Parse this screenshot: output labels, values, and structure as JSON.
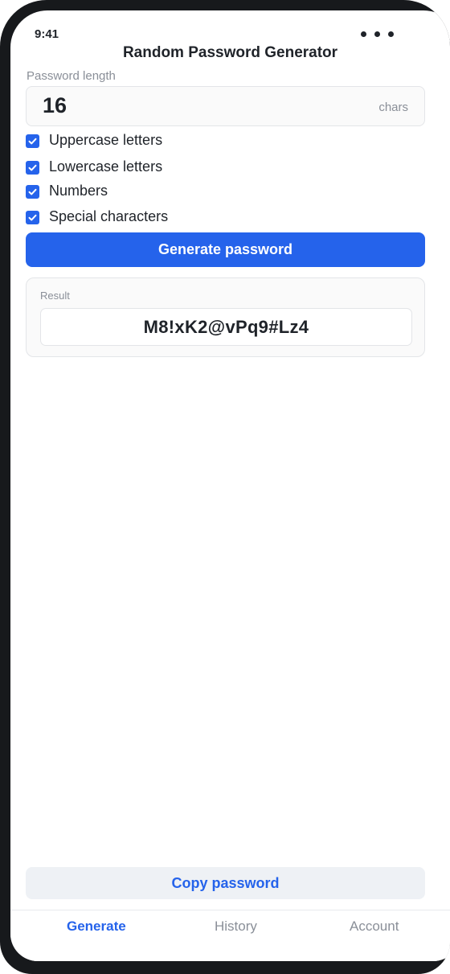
{
  "status_bar": {
    "time": "9:41"
  },
  "header": {
    "title": "Random Password Generator"
  },
  "length": {
    "label": "Password length",
    "value": "16",
    "unit": "chars"
  },
  "options": [
    {
      "label": "Uppercase letters",
      "checked": true
    },
    {
      "label": "Lowercase letters",
      "checked": true
    },
    {
      "label": "Numbers",
      "checked": true
    },
    {
      "label": "Special characters",
      "checked": true
    }
  ],
  "actions": {
    "generate_label": "Generate password",
    "copy_label": "Copy password"
  },
  "result": {
    "label": "Result",
    "value": "M8!xK2@vPq9#Lz4"
  },
  "tabs": [
    {
      "label": "Generate",
      "active": true
    },
    {
      "label": "History",
      "active": false
    },
    {
      "label": "Account",
      "active": false
    }
  ],
  "colors": {
    "accent": "#2563eb",
    "text": "#1f2329",
    "muted": "#8a8f98",
    "frame": "#17191c"
  },
  "icons": {
    "checkbox": "check-icon",
    "menu": "more-horizontal-icon"
  }
}
